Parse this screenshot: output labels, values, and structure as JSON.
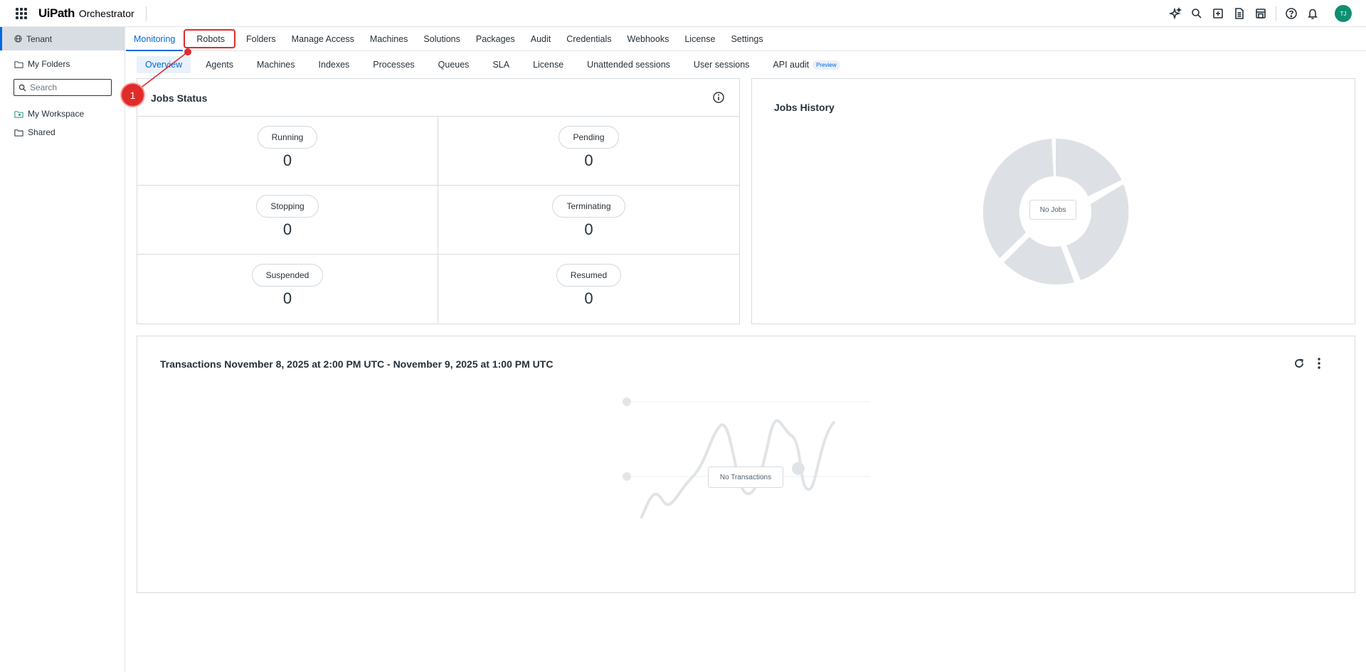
{
  "header": {
    "logo": "UiPath",
    "product": "Orchestrator",
    "avatar_initials": "TJ",
    "icons": [
      "autopilot-icon",
      "search-icon",
      "add-icon",
      "document-icon",
      "store-icon",
      "help-icon",
      "bell-icon"
    ]
  },
  "sidebar": {
    "tenant": "Tenant",
    "my_folders": "My Folders",
    "search_placeholder": "Search",
    "items": [
      {
        "label": "My Workspace",
        "icon": "workspace-icon"
      },
      {
        "label": "Shared",
        "icon": "folder-icon"
      }
    ]
  },
  "main_tabs": [
    "Monitoring",
    "Robots",
    "Folders",
    "Manage Access",
    "Machines",
    "Solutions",
    "Packages",
    "Audit",
    "Credentials",
    "Webhooks",
    "License",
    "Settings"
  ],
  "sub_tabs": [
    "Overview",
    "Agents",
    "Machines",
    "Indexes",
    "Processes",
    "Queues",
    "SLA",
    "License",
    "Unattended sessions",
    "User sessions",
    "API audit"
  ],
  "preview_badge": "Preview",
  "jobs_status": {
    "title": "Jobs Status",
    "items": [
      {
        "label": "Running",
        "value": "0"
      },
      {
        "label": "Pending",
        "value": "0"
      },
      {
        "label": "Stopping",
        "value": "0"
      },
      {
        "label": "Terminating",
        "value": "0"
      },
      {
        "label": "Suspended",
        "value": "0"
      },
      {
        "label": "Resumed",
        "value": "0"
      }
    ]
  },
  "jobs_history": {
    "title": "Jobs History",
    "empty_label": "No Jobs"
  },
  "transactions": {
    "title": "Transactions November 8, 2025 at 2:00 PM UTC - November 9, 2025 at 1:00 PM UTC",
    "empty_label": "No Transactions"
  },
  "annotation": {
    "step": "1"
  },
  "colors": {
    "accent": "#0067df",
    "annotation": "#e02b2b",
    "avatar": "#0e8f73",
    "placeholder_graphic": "#dde1e5"
  }
}
